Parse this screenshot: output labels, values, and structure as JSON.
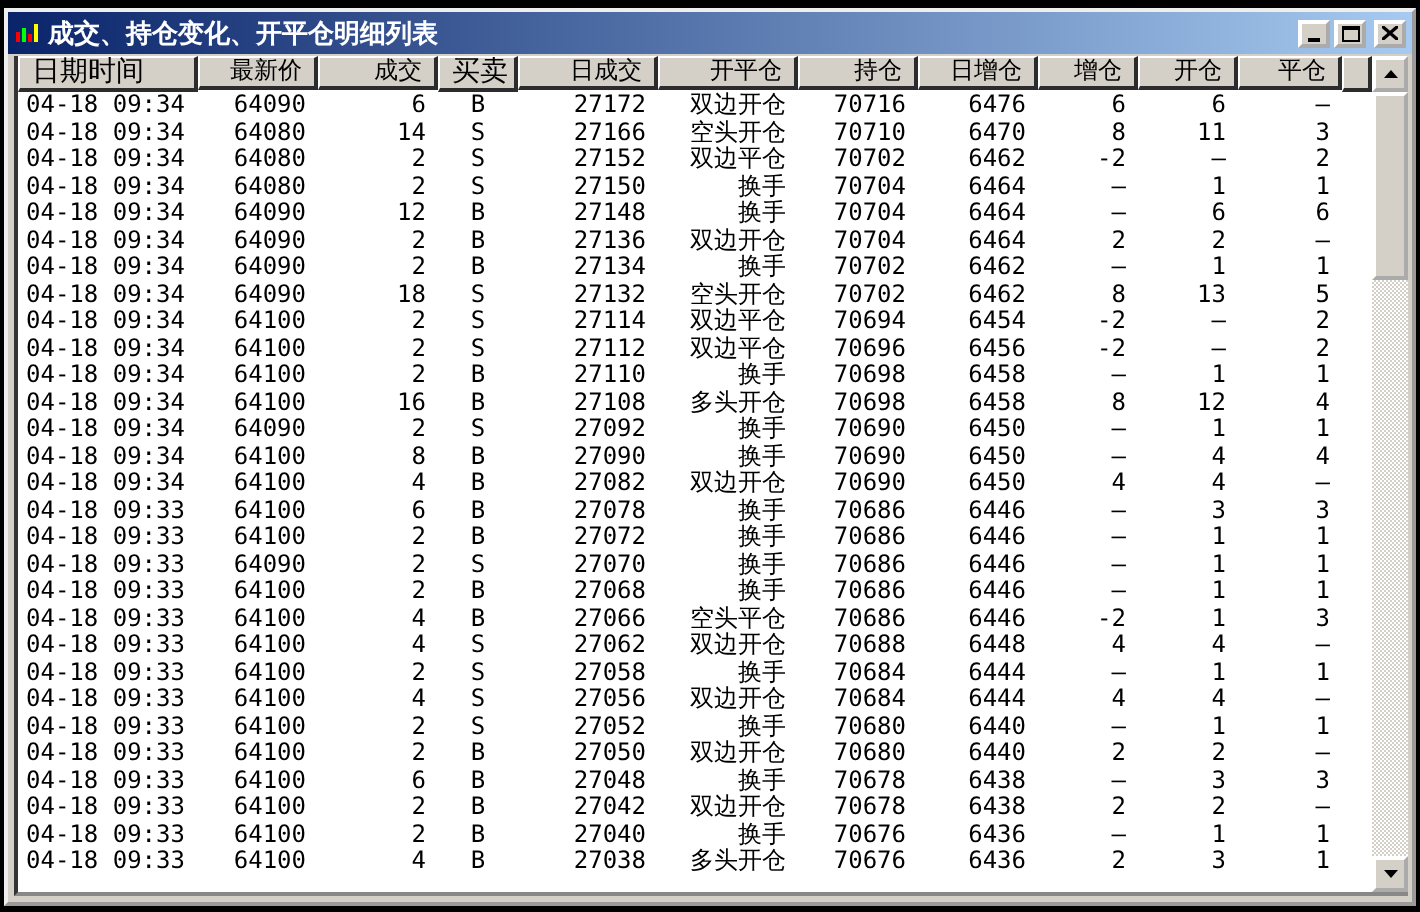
{
  "window": {
    "title": "成交、持仓变化、开平仓明细列表",
    "active": true
  },
  "table": {
    "columns": [
      "日期时间",
      "最新价",
      "成交",
      "买卖",
      "日成交",
      "开平仓",
      "持仓",
      "日增仓",
      "增仓",
      "开仓",
      "平仓"
    ],
    "rows": [
      {
        "cells": [
          "04-18 09:34",
          "64090",
          "6",
          "B",
          "27172",
          "双边开仓",
          "70716",
          "6476",
          "6",
          "6",
          "—"
        ]
      },
      {
        "cells": [
          "04-18 09:34",
          "64080",
          "14",
          "S",
          "27166",
          "空头开仓",
          "70710",
          "6470",
          "8",
          "11",
          "3"
        ]
      },
      {
        "cells": [
          "04-18 09:34",
          "64080",
          "2",
          "S",
          "27152",
          "双边平仓",
          "70702",
          "6462",
          "-2",
          "—",
          "2"
        ]
      },
      {
        "cells": [
          "04-18 09:34",
          "64080",
          "2",
          "S",
          "27150",
          "换手",
          "70704",
          "6464",
          "—",
          "1",
          "1"
        ]
      },
      {
        "cells": [
          "04-18 09:34",
          "64090",
          "12",
          "B",
          "27148",
          "换手",
          "70704",
          "6464",
          "—",
          "6",
          "6"
        ]
      },
      {
        "cells": [
          "04-18 09:34",
          "64090",
          "2",
          "B",
          "27136",
          "双边开仓",
          "70704",
          "6464",
          "2",
          "2",
          "—"
        ]
      },
      {
        "cells": [
          "04-18 09:34",
          "64090",
          "2",
          "B",
          "27134",
          "换手",
          "70702",
          "6462",
          "—",
          "1",
          "1"
        ]
      },
      {
        "cells": [
          "04-18 09:34",
          "64090",
          "18",
          "S",
          "27132",
          "空头开仓",
          "70702",
          "6462",
          "8",
          "13",
          "5"
        ]
      },
      {
        "cells": [
          "04-18 09:34",
          "64100",
          "2",
          "S",
          "27114",
          "双边平仓",
          "70694",
          "6454",
          "-2",
          "—",
          "2"
        ]
      },
      {
        "cells": [
          "04-18 09:34",
          "64100",
          "2",
          "S",
          "27112",
          "双边平仓",
          "70696",
          "6456",
          "-2",
          "—",
          "2"
        ]
      },
      {
        "cells": [
          "04-18 09:34",
          "64100",
          "2",
          "B",
          "27110",
          "换手",
          "70698",
          "6458",
          "—",
          "1",
          "1"
        ]
      },
      {
        "cells": [
          "04-18 09:34",
          "64100",
          "16",
          "B",
          "27108",
          "多头开仓",
          "70698",
          "6458",
          "8",
          "12",
          "4"
        ]
      },
      {
        "cells": [
          "04-18 09:34",
          "64090",
          "2",
          "S",
          "27092",
          "换手",
          "70690",
          "6450",
          "—",
          "1",
          "1"
        ]
      },
      {
        "cells": [
          "04-18 09:34",
          "64100",
          "8",
          "B",
          "27090",
          "换手",
          "70690",
          "6450",
          "—",
          "4",
          "4"
        ]
      },
      {
        "cells": [
          "04-18 09:34",
          "64100",
          "4",
          "B",
          "27082",
          "双边开仓",
          "70690",
          "6450",
          "4",
          "4",
          "—"
        ]
      },
      {
        "cells": [
          "04-18 09:33",
          "64100",
          "6",
          "B",
          "27078",
          "换手",
          "70686",
          "6446",
          "—",
          "3",
          "3"
        ]
      },
      {
        "cells": [
          "04-18 09:33",
          "64100",
          "2",
          "B",
          "27072",
          "换手",
          "70686",
          "6446",
          "—",
          "1",
          "1"
        ]
      },
      {
        "cells": [
          "04-18 09:33",
          "64090",
          "2",
          "S",
          "27070",
          "换手",
          "70686",
          "6446",
          "—",
          "1",
          "1"
        ]
      },
      {
        "cells": [
          "04-18 09:33",
          "64100",
          "2",
          "B",
          "27068",
          "换手",
          "70686",
          "6446",
          "—",
          "1",
          "1"
        ]
      },
      {
        "cells": [
          "04-18 09:33",
          "64100",
          "4",
          "B",
          "27066",
          "空头平仓",
          "70686",
          "6446",
          "-2",
          "1",
          "3"
        ]
      },
      {
        "cells": [
          "04-18 09:33",
          "64100",
          "4",
          "S",
          "27062",
          "双边开仓",
          "70688",
          "6448",
          "4",
          "4",
          "—"
        ]
      },
      {
        "cells": [
          "04-18 09:33",
          "64100",
          "2",
          "S",
          "27058",
          "换手",
          "70684",
          "6444",
          "—",
          "1",
          "1"
        ]
      },
      {
        "cells": [
          "04-18 09:33",
          "64100",
          "4",
          "S",
          "27056",
          "双边开仓",
          "70684",
          "6444",
          "4",
          "4",
          "—"
        ]
      },
      {
        "cells": [
          "04-18 09:33",
          "64100",
          "2",
          "S",
          "27052",
          "换手",
          "70680",
          "6440",
          "—",
          "1",
          "1"
        ]
      },
      {
        "cells": [
          "04-18 09:33",
          "64100",
          "2",
          "B",
          "27050",
          "双边开仓",
          "70680",
          "6440",
          "2",
          "2",
          "—"
        ]
      },
      {
        "cells": [
          "04-18 09:33",
          "64100",
          "6",
          "B",
          "27048",
          "换手",
          "70678",
          "6438",
          "—",
          "3",
          "3"
        ]
      },
      {
        "cells": [
          "04-18 09:33",
          "64100",
          "2",
          "B",
          "27042",
          "双边开仓",
          "70678",
          "6438",
          "2",
          "2",
          "—"
        ]
      },
      {
        "cells": [
          "04-18 09:33",
          "64100",
          "2",
          "B",
          "27040",
          "换手",
          "70676",
          "6436",
          "—",
          "1",
          "1"
        ]
      },
      {
        "cells": [
          "04-18 09:33",
          "64100",
          "4",
          "B",
          "27038",
          "多头开仓",
          "70676",
          "6436",
          "2",
          "3",
          "1"
        ]
      }
    ]
  }
}
